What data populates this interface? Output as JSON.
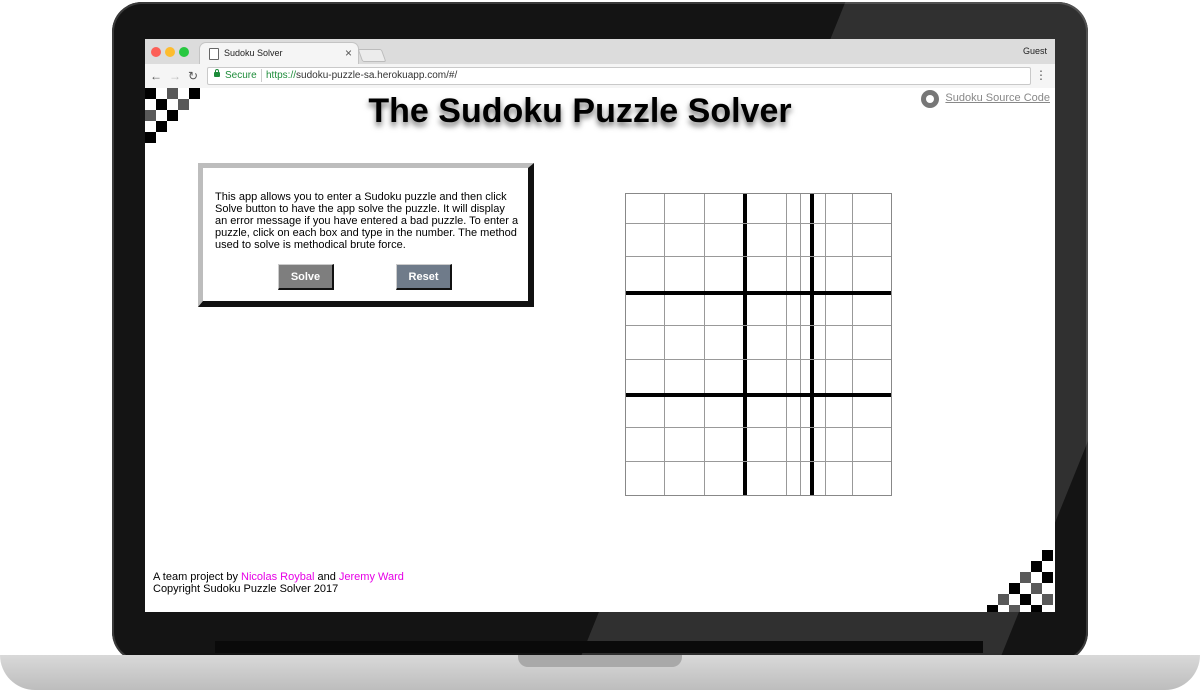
{
  "browser": {
    "tab_title": "Sudoku Solver",
    "tab_close": "×",
    "profile": "Guest",
    "secure_label": "Secure",
    "url_scheme": "https://",
    "url_rest": "sudoku-puzzle-sa.herokuapp.com/#/",
    "back": "←",
    "forward": "→",
    "reload": "↻",
    "menu": "⋮"
  },
  "page": {
    "title": "The Sudoku Puzzle Solver",
    "source_link": "Sudoku Source Code",
    "description": "This app allows you to enter a Sudoku puzzle and then click Solve button to have the app solve the puzzle. It will display an error message if you have entered a bad puzzle. To enter a puzzle, click on each box and type in the number. The method used to solve is methodical brute force.",
    "solve_label": "Solve",
    "reset_label": "Reset"
  },
  "footer": {
    "prefix": "A team project by ",
    "author1": "Nicolas Roybal",
    "joiner": " and ",
    "author2": "Jeremy Ward",
    "copyright": "Copyright Sudoku Puzzle Solver 2017"
  },
  "grid": {
    "rows": 9,
    "cols": 9,
    "cells_empty": true
  }
}
